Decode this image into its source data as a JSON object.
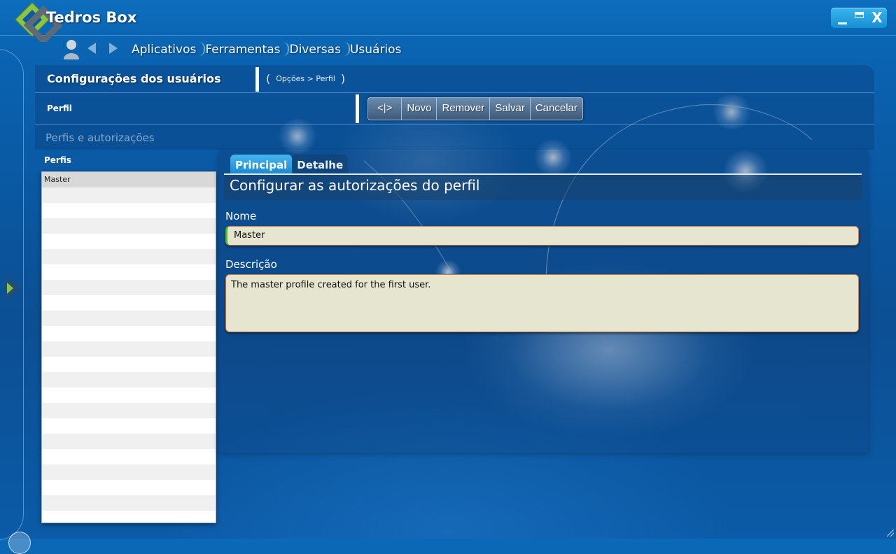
{
  "app": {
    "title": "Tedros Box"
  },
  "window_controls": {
    "close_label": "X"
  },
  "breadcrumbs": [
    "Aplicativos",
    "Ferramentas",
    "Diversas",
    "Usuários"
  ],
  "section": {
    "title": "Configurações dos usuários",
    "path": "Opções > Perfil",
    "paren_open": "(",
    "paren_close": ")"
  },
  "profile": {
    "title": "Perfil"
  },
  "toolbar": {
    "toggle_label": "<|>",
    "new_label": "Novo",
    "remove_label": "Remover",
    "save_label": "Salvar",
    "cancel_label": "Cancelar"
  },
  "subsection": {
    "title": "Perfis e autorizações"
  },
  "profiles_list": {
    "title": "Perfis",
    "items": [
      "Master"
    ],
    "selected": "Master"
  },
  "tabs": [
    {
      "label": "Principal",
      "active": true
    },
    {
      "label": "Detalhe",
      "active": false
    }
  ],
  "detail": {
    "title": "Configurar as autorizações do perfil",
    "name_label": "Nome",
    "name_value": "Master",
    "description_label": "Descrição",
    "description_value": "The master profile created for the first user."
  },
  "colors": {
    "background": "#0b5ba8",
    "tab_active": "#1989d1",
    "field_background": "#e6e5cf",
    "field_border": "#c07a4a",
    "focus_indicator": "#58b23c"
  }
}
